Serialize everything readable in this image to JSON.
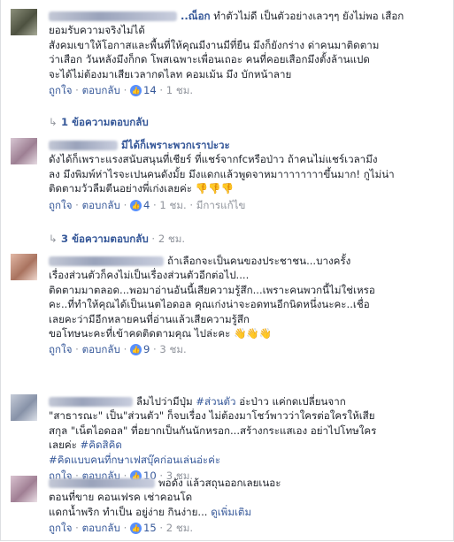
{
  "comments": [
    {
      "name_suffix": "..ณ็อก",
      "lines": [
        "ทำตัวไม่ดี เป็นตัวอย่างเลวๆๆ ยังไม่พอ เสือก",
        "ยอมรับความจริงไม่ได้",
        "สังคมเขาให้โอกาสและพื้นที่ให้คุณมีงานมีที่ยืน มึงก็ยังกร่าง ด่าคนมาติดตาม",
        "ว่าเสือก วันหลังมึงก็กด โพสเฉพาะเพื่อนเถอะ คนที่คอยเสือกมึงตั้งล้านแปด",
        "จะได้ไม่ต้องมาเสียเวลากดไลท คอมเม้น มึง บักหน้าลาย"
      ],
      "like": "ถูกใจ",
      "reply": "ตอบกลับ",
      "likes": "14",
      "time": "1 ชม.",
      "edited": ""
    },
    {
      "name_suffix": "มีได้ก็เพราะพวกเราปะวะ",
      "lines": [
        "ดังได้ก็เพราะแรงสนับสนุนที่เชียร์ ที่แชร์จากfcหรือป่าว ถ้าคนไม่แชร์เวลามึง",
        "ลง มึงพิมพ์ห่าไรจะเปนคนดังมั้ย มึงแดกแล้วพูดจาหมาาาาาาาาขึ้นมาก! กูไม่น่า",
        "ติดตามวัวลืมตีนอย่างพี่เก่งเลยค่ะ "
      ],
      "emoji": "👎👎👎",
      "like": "ถูกใจ",
      "reply": "ตอบกลับ",
      "likes": "4",
      "time": "1 ชม.",
      "edited": "มีการแก้ไข"
    },
    {
      "name_suffix": "ถ้าเลือกจะเป็นคนของประชาชน...บางครั้ง",
      "lines": [
        "เรื่องส่วนตัวก็คงไม่เป็นเรื่องส่วนตัวอีกต่อไป....",
        "ติดตามมาตลอด...พอมาอ่านอันนี้เสียความรู้สึก...เพราะคนพวกนี้ไม่ใช่เหรอ",
        "คะ..ที่ทำให้คุณได้เป็นเนตไอดอล คุณเก่งน่าจะอดทนอีกนิดหนึ่งนะคะ..เชื่อ",
        "เลยคะว่ามีอีกหลายคนที่อ่านแล้วเสียความรู้สึก",
        "ขอโทษนะคะที่เข้าคดติดตามคุณ ไปล่ะคะ "
      ],
      "emoji": "👋👋👋",
      "like": "ถูกใจ",
      "reply": "ตอบกลับ",
      "likes": "9",
      "time": "3 ชม.",
      "edited": ""
    },
    {
      "name_suffix": "ลืมไปว่ามีปุ่ม",
      "hash_inline": "#ส่วนตัว",
      "first_tail": " อ่ะป่าว แค่กดเปลี่ยนจาก",
      "lines": [
        "\"สาธารณะ\" เป็น\"ส่วนตัว\" ก็จบเรื่อง ไม่ต้องมาโชว์พาวว่าใครต่อใครให้เสีย",
        "สกุล \"เน็ตไอดอล\" ที่อยากเป็นกันนักหรอก...สร้างกระแสเอง อย่าไปโทษใคร",
        "เลยค่ะ "
      ],
      "hash_end": "#คิดสิคิด",
      "hash_line": "#คิดแบบคนที่กษาเฟสบุ๊คก่อนเล่นอ่ะค่ะ",
      "like": "ถูกใจ",
      "reply": "ตอบกลับ",
      "likes": "10",
      "time": "3 ชม.",
      "edited": ""
    },
    {
      "name_suffix": "พอดัง แล้วสถุนออกเลยเนอะ",
      "lines": [
        "ตอนที่ขาย คอนเฟรค เช่าคอนโด",
        "แดกน้ำพริก ทำเป็น อยู่ง่าย กินง่าย..."
      ],
      "see_more": "ดูเพิ่มเติม",
      "like": "ถูกใจ",
      "reply": "ตอบกลับ",
      "likes": "15",
      "time": "2 ชม.",
      "edited": ""
    }
  ],
  "reply_rows": [
    {
      "text": "1 ข้อความตอบกลับ",
      "time": ""
    },
    {
      "text": "3 ข้อความตอบกลับ",
      "time": "2 ชม."
    }
  ],
  "sep": " · "
}
